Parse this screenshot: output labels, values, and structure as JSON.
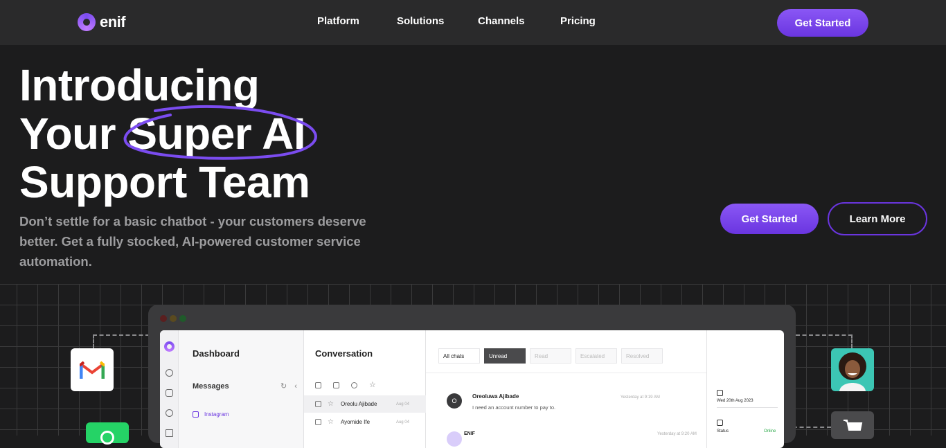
{
  "brand": {
    "name": "enif"
  },
  "nav": {
    "links": [
      "Platform",
      "Solutions",
      "Channels",
      "Pricing"
    ],
    "cta": "Get Started"
  },
  "hero": {
    "title_lines": [
      "Introducing",
      "Your Super AI",
      "Support Team"
    ],
    "subtitle": "Don’t settle for a basic chatbot - your customers deserve better. Get a fully stocked, AI-powered customer service automation.",
    "primary_cta": "Get Started",
    "secondary_cta": "Learn More"
  },
  "app_preview": {
    "sidebar": {
      "title": "Dashboard",
      "messages_label": "Messages",
      "channel": "Instagram"
    },
    "conversation": {
      "title": "Conversation",
      "rows": [
        {
          "name": "Oreolu Ajibade",
          "date": "Aug 04"
        },
        {
          "name": "Ayomide Ife",
          "date": "Aug 04"
        }
      ]
    },
    "filters": [
      "All chats",
      "Unread",
      "Read",
      "Escalated",
      "Resolved"
    ],
    "messages": [
      {
        "avatar": "O",
        "name": "Oreoluwa Ajibade",
        "text": "I need an account number to pay to.",
        "time": "Yesterday at 9:19 AM"
      },
      {
        "name": "ENIF",
        "time": "Yesterday at 9:20 AM"
      }
    ],
    "details": {
      "date": "Wed 20th Aug 2023",
      "status_label": "Status",
      "status_value": "Online"
    }
  },
  "colors": {
    "accent": "#7b4cf0",
    "background": "#1c1c1d",
    "nav_bg": "#2a2a2b",
    "subtitle": "#9d9d9f"
  },
  "icons": {
    "left_tiles": [
      "gmail-icon",
      "whatsapp-icon"
    ],
    "right_tiles": [
      "customer-avatar-icon",
      "cart-icon"
    ]
  }
}
